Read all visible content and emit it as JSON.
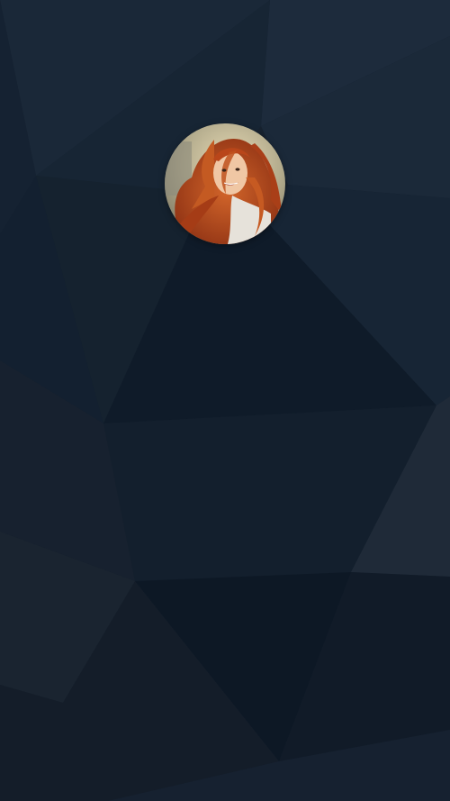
{
  "screen": {
    "background_style": "dark low-poly navy",
    "base_color": "#16222f"
  },
  "profile": {
    "avatar_icon": "profile-photo-avatar",
    "hair_color": "#b8481c",
    "frame_shape": "circle"
  }
}
